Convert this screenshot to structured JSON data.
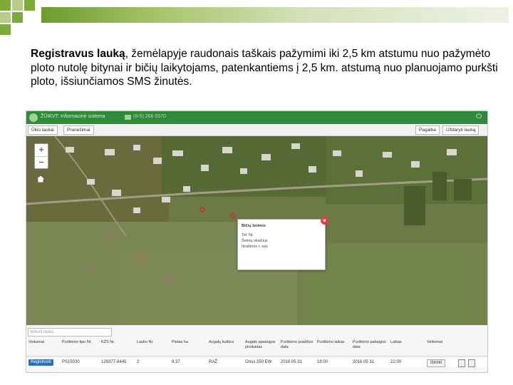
{
  "slide": {
    "bold_lead": "Registravus lauką",
    "text_rest": ", žemėlapyje raudonais taškais pažymimi iki 2,5 km atstumu nuo pažymėto ploto nutolę bitynai ir bičių laikytojams, patenkantiems į 2,5 km. atstumą nuo planuojamo purkšti ploto, išsiunčiamos SMS žinutės."
  },
  "app": {
    "header": {
      "title": "ŽŪIKVT: Informacinė sistema",
      "phone": "(8-5) 266 0570",
      "logo_icon": "leaf-logo-icon",
      "power_icon": "power-icon"
    },
    "toolbar": {
      "tab_fields": "Ūkio laukai",
      "tab_notices": "Pranešimai",
      "help": "Pagalba",
      "add_field": "Uždaryti lauką"
    },
    "map": {
      "zoom_in": "+",
      "zoom_out": "−",
      "popup": {
        "title": "Bičių šeimos",
        "line1": "Tel. Nr.",
        "line2": "Šeimų skaičius",
        "line3": "Išrašinos r. sav."
      },
      "marker_color": "#cc2a2a"
    },
    "grid": {
      "filter_placeholder": "Ieškoti lauko",
      "headers": [
        "Veiksmai",
        "Purškimo tipo Nr.",
        "KŽS Nr.",
        "Lauko Nr.",
        "Plotas ha",
        "Augalų kultūra",
        "Augalo apsaugos produktas",
        "Purškimo pradžios data",
        "Purškimo laikas",
        "Purškimo pabaigos data",
        "Laikas",
        "Veiksmai"
      ],
      "row": {
        "action": "Registruoti",
        "spray_no": "PS15030",
        "kzs": "129377-8445",
        "field": "2",
        "area": "9.37",
        "crop": "RAŽ",
        "product": "Onus 250 EW",
        "start_date": "2016 05 31",
        "start_time": "18:00",
        "end_date": "2016 05 31",
        "end_time": "22:00",
        "delete": "Ištrinti"
      }
    }
  }
}
